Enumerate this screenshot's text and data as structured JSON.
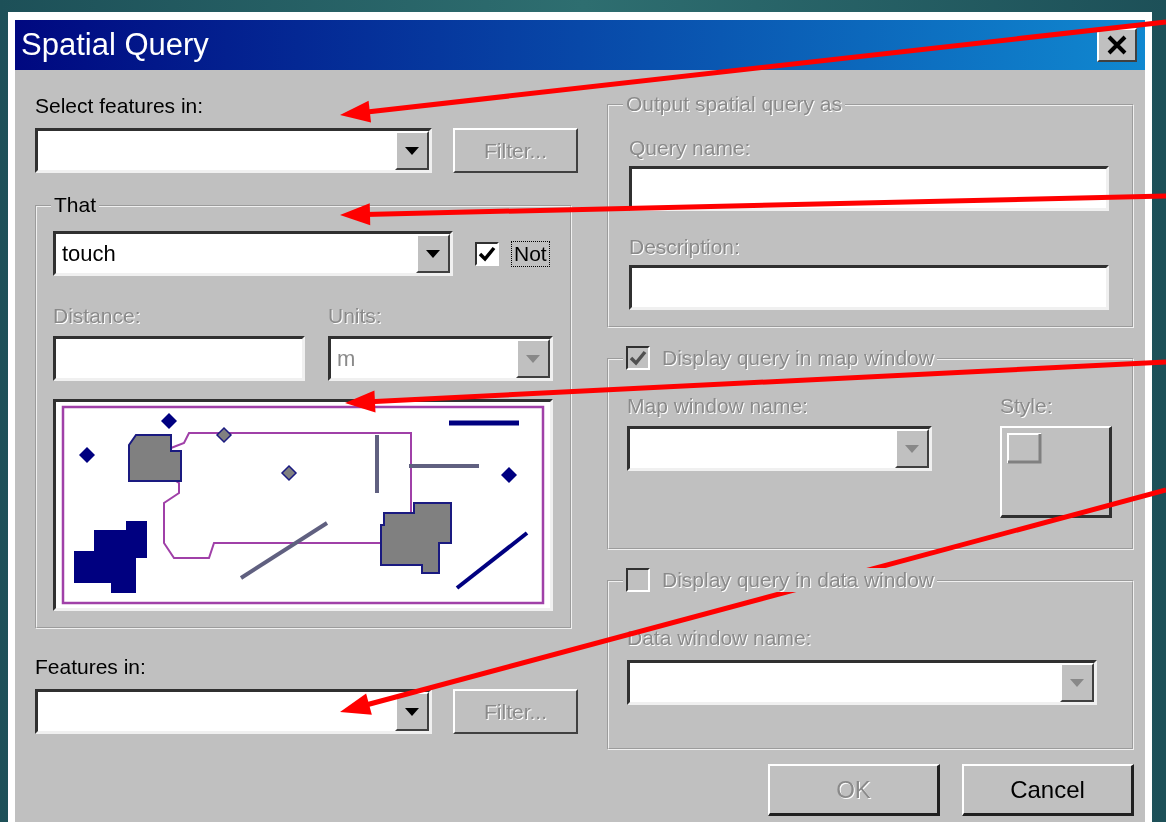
{
  "window": {
    "title": "Spatial Query"
  },
  "select_features": {
    "label": "Select features in:",
    "filter_button": {
      "label": "Filter...",
      "disabled": true
    }
  },
  "that": {
    "legend": "That",
    "operator": "touch",
    "not_checkbox": {
      "label": "Not",
      "checked": true
    },
    "distance": {
      "label": "Distance:",
      "disabled": true
    },
    "units": {
      "label": "Units:",
      "value": "m",
      "disabled": true
    }
  },
  "features_in": {
    "label": "Features in:",
    "filter_button": {
      "label": "Filter...",
      "disabled": true
    }
  },
  "output": {
    "legend": "Output spatial query as",
    "disabled": true,
    "query_name_label": "Query name:",
    "description_label": "Description:"
  },
  "map_window": {
    "label": "Display query in map window",
    "checked": true,
    "disabled": true,
    "name_label": "Map window name:",
    "style_label": "Style:"
  },
  "data_window": {
    "label": "Display query in data window",
    "checked": false,
    "disabled": true,
    "name_label": "Data window name:"
  },
  "buttons": [
    {
      "label": "OK",
      "disabled": true
    },
    {
      "label": "Cancel",
      "disabled": false
    }
  ]
}
